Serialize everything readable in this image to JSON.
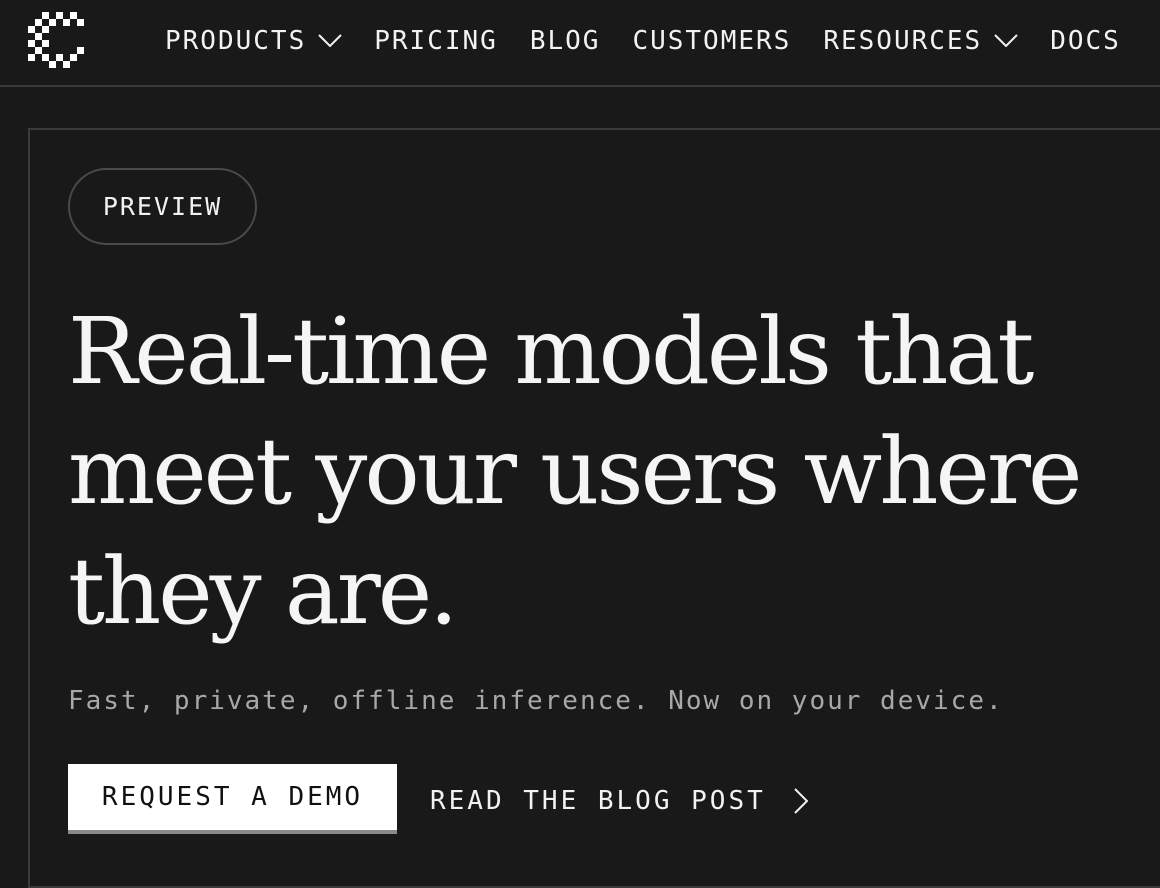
{
  "nav": {
    "logo_icon": "pixel-c-logo-icon",
    "items": [
      {
        "label": "PRODUCTS",
        "has_dropdown": true
      },
      {
        "label": "PRICING",
        "has_dropdown": false
      },
      {
        "label": "BLOG",
        "has_dropdown": false
      },
      {
        "label": "CUSTOMERS",
        "has_dropdown": false
      },
      {
        "label": "RESOURCES",
        "has_dropdown": true
      },
      {
        "label": "DOCS",
        "has_dropdown": false
      }
    ]
  },
  "hero": {
    "badge": "PREVIEW",
    "headline": "Real-time models that meet your users where they are.",
    "subtitle": "Fast, private, offline inference. Now on your device.",
    "primary_cta": "REQUEST A DEMO",
    "secondary_cta": "READ THE BLOG POST",
    "secondary_icon": "chevron-right-icon"
  },
  "colors": {
    "background": "#191919",
    "text": "#f2f2f2",
    "muted_text": "#a8a8a8",
    "border": "#3a3a3a",
    "button_bg": "#ffffff",
    "button_text": "#111111"
  }
}
